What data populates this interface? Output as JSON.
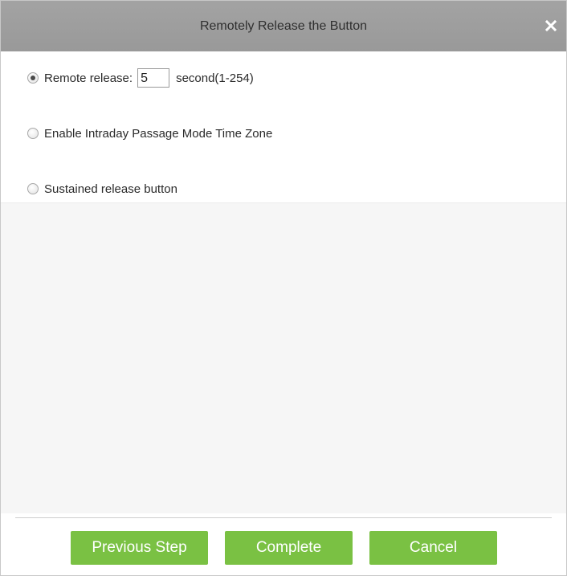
{
  "dialog": {
    "title": "Remotely Release the Button",
    "close_icon": "close-icon"
  },
  "options": {
    "remote_release": {
      "label": "Remote release:",
      "seconds_value": "5",
      "range_hint": "second(1-254)",
      "selected": true
    },
    "intraday": {
      "label": "Enable Intraday Passage Mode Time Zone",
      "selected": false
    },
    "sustained": {
      "label": "Sustained release button",
      "selected": false
    }
  },
  "footer": {
    "previous_label": "Previous Step",
    "complete_label": "Complete",
    "cancel_label": "Cancel"
  },
  "colors": {
    "titlebar": "#9e9e9e",
    "button_green": "#7ac143",
    "content_bg": "#f6f6f6"
  }
}
